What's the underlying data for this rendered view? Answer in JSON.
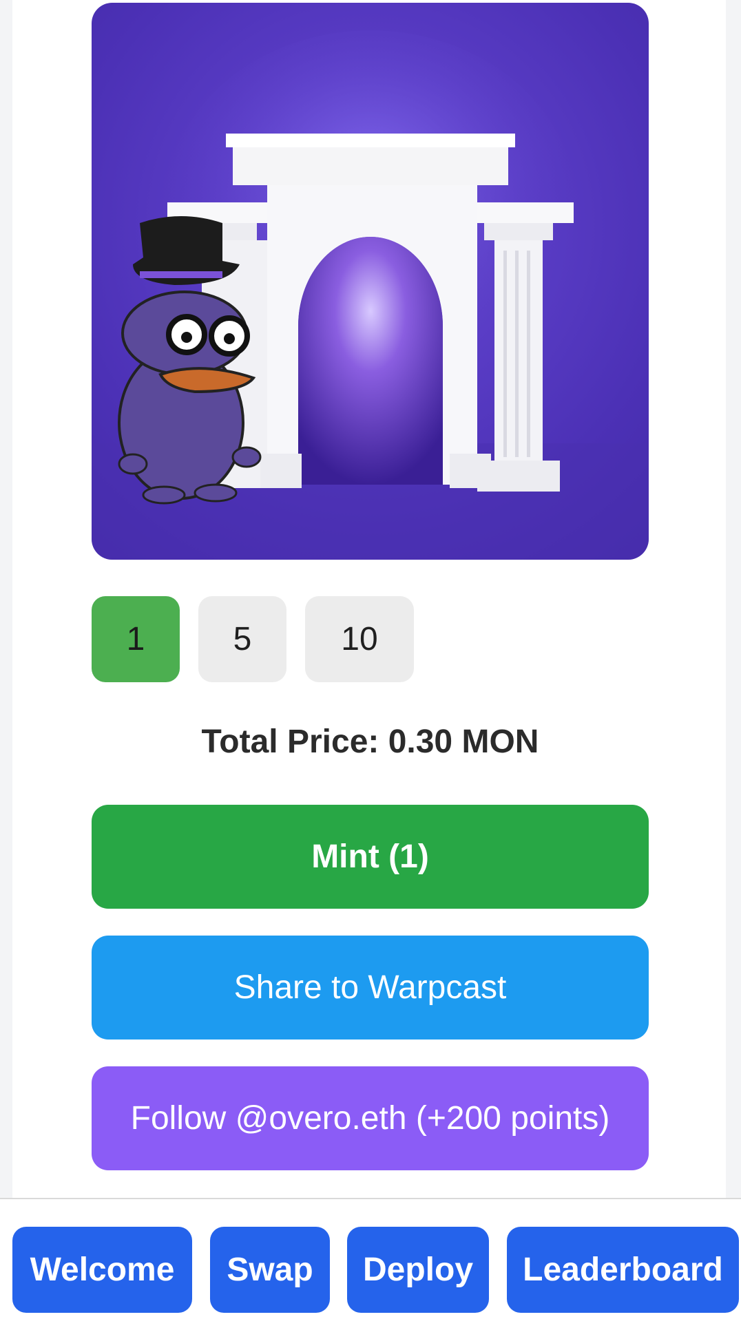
{
  "quantity": {
    "options": [
      "1",
      "5",
      "10"
    ],
    "selected": "1"
  },
  "total_price": "Total Price: 0.30 MON",
  "actions": {
    "mint": "Mint (1)",
    "share": "Share to Warpcast",
    "follow": "Follow @overo.eth (+200 points)"
  },
  "nav": {
    "welcome": "Welcome",
    "swap": "Swap",
    "deploy": "Deploy",
    "leaderboard": "Leaderboard"
  },
  "colors": {
    "qty_active": "#4caf50",
    "mint": "#28a745",
    "share": "#1d9bf0",
    "follow": "#8b5cf6",
    "nav": "#2563eb"
  }
}
